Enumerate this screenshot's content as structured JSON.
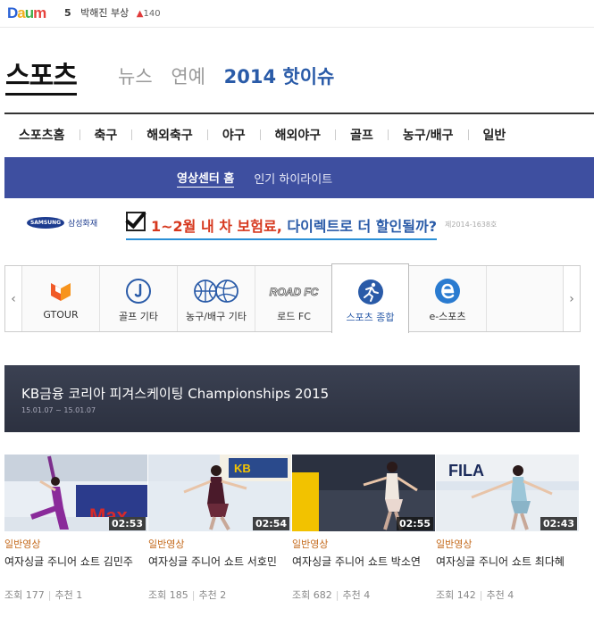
{
  "topbar": {
    "logo": "Daum",
    "rank_num": "5",
    "rank_title": "박해진 부상",
    "rank_change": "140"
  },
  "header": {
    "title": "스포츠",
    "links": [
      "뉴스",
      "연예"
    ],
    "hot_link": "2014 핫이슈"
  },
  "nav": {
    "items": [
      "스포츠홈",
      "축구",
      "해외축구",
      "야구",
      "해외야구",
      "골프",
      "농구/배구",
      "일반"
    ]
  },
  "subnav": {
    "home": "영상센터 홈",
    "highlight": "인기 하이라이트"
  },
  "ad": {
    "brand_logo": "SAMSUNG",
    "brand": "삼성화재",
    "text_red": "1~2월 내 차 보험료,",
    "text_blue": " 다이렉트로 더 할인될까?",
    "note": "제2014-1638호"
  },
  "categories": [
    {
      "label": "GTOUR",
      "icon": "gtour-icon"
    },
    {
      "label": "골프 기타",
      "icon": "golf-icon"
    },
    {
      "label": "농구/배구 기타",
      "icon": "ball-icon"
    },
    {
      "label": "로드 FC",
      "icon": "roadfc-icon",
      "logo_text": "ROAD FC"
    },
    {
      "label": "스포츠 종합",
      "icon": "runner-icon"
    },
    {
      "label": "e-스포츠",
      "icon": "esports-icon"
    }
  ],
  "event": {
    "title": "KB금융 코리아 피겨스케이팅 Championships 2015",
    "date": "15.01.07 ~ 15.01.07"
  },
  "videos": [
    {
      "duration": "02:53",
      "category": "일반영상",
      "title": "여자싱글 주니어 쇼트 김민주",
      "views": "조회 177",
      "recommend": "추천 1"
    },
    {
      "duration": "02:54",
      "category": "일반영상",
      "title": "여자싱글 주니어 쇼트 서호민",
      "views": "조회 185",
      "recommend": "추천 2"
    },
    {
      "duration": "02:55",
      "category": "일반영상",
      "title": "여자싱글 주니어 쇼트 박소연",
      "views": "조회 682",
      "recommend": "추천 4"
    },
    {
      "duration": "02:43",
      "category": "일반영상",
      "title": "여자싱글 주니어 쇼트 최다혜",
      "views": "조회 142",
      "recommend": "추천 4"
    }
  ],
  "colors": {
    "nav_blue": "#3e4fa0",
    "accent_blue": "#2a5ba8",
    "category_orange": "#c46a1c"
  }
}
